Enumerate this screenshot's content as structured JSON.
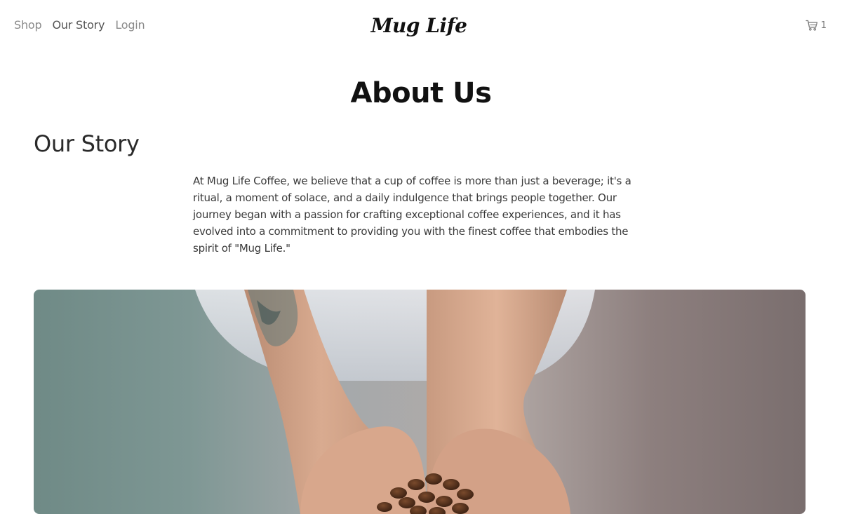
{
  "nav": {
    "items": [
      {
        "label": "Shop"
      },
      {
        "label": "Our Story"
      },
      {
        "label": "Login"
      }
    ]
  },
  "brand": {
    "logo_text": "Mug Life"
  },
  "cart": {
    "icon": "cart-icon",
    "count": "1"
  },
  "main": {
    "title": "About Us",
    "section_title": "Our Story",
    "paragraph": "At Mug Life Coffee, we believe that a cup of coffee is more than just a beverage; it's a ritual, a moment of solace, and a daily indulgence that brings people together. Our journey began with a passion for crafting exceptional coffee experiences, and it has evolved into a commitment to providing you with the finest coffee that embodies the spirit of \"Mug Life.\""
  },
  "colors": {
    "text_dark": "#111111",
    "nav_text": "#8a8a8a",
    "body_text": "#3a3a3a"
  }
}
